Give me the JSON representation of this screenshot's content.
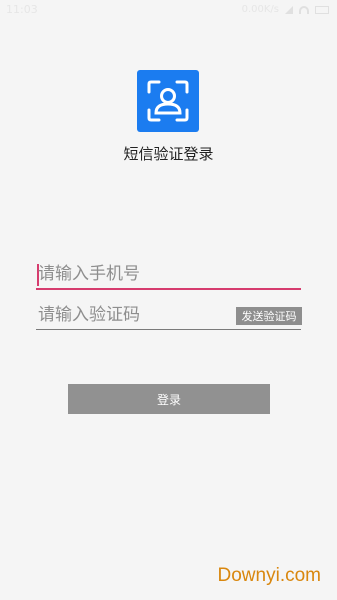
{
  "status_bar": {
    "time": "11:03",
    "right_text": "0.00K/s"
  },
  "app": {
    "title": "短信验证登录",
    "logo_icon": "face-scan-icon",
    "accent_color": "#1b7cf0"
  },
  "form": {
    "phone_placeholder": "请输入手机号",
    "phone_value": "",
    "code_placeholder": "请输入验证码",
    "code_value": "",
    "send_code_label": "发送验证码",
    "login_label": "登录",
    "focus_color": "#d63c6e"
  },
  "watermark": {
    "text": "Downyi.com"
  }
}
